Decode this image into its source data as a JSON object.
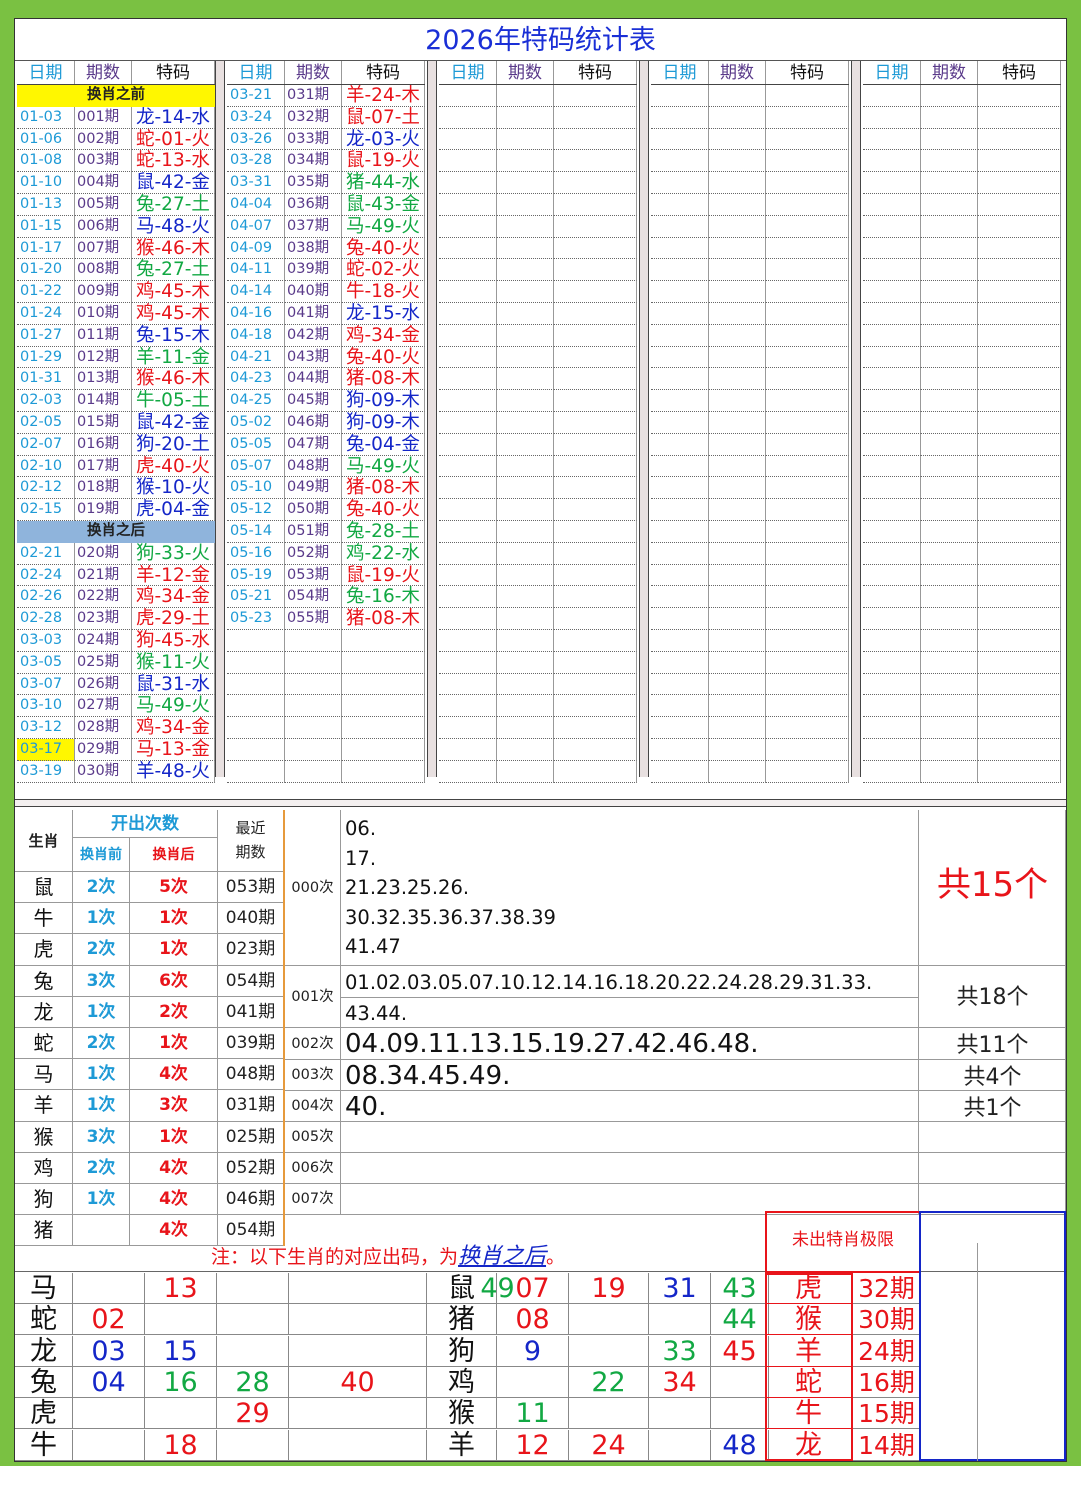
{
  "title": "2026年特码统计表",
  "headers": {
    "date": "日期",
    "num": "期数",
    "code": "特码"
  },
  "band_before": "换肖之前",
  "band_after": "换肖之后",
  "col1": [
    [
      "01-03",
      "001期",
      "龙-14-水",
      "blue"
    ],
    [
      "01-06",
      "002期",
      "蛇-01-火",
      "red"
    ],
    [
      "01-08",
      "003期",
      "蛇-13-水",
      "red"
    ],
    [
      "01-10",
      "004期",
      "鼠-42-金",
      "blue"
    ],
    [
      "01-13",
      "005期",
      "兔-27-土",
      "green"
    ],
    [
      "01-15",
      "006期",
      "马-48-火",
      "blue"
    ],
    [
      "01-17",
      "007期",
      "猴-46-木",
      "red"
    ],
    [
      "01-20",
      "008期",
      "兔-27-土",
      "green"
    ],
    [
      "01-22",
      "009期",
      "鸡-45-木",
      "red"
    ],
    [
      "01-24",
      "010期",
      "鸡-45-木",
      "red"
    ],
    [
      "01-27",
      "011期",
      "兔-15-木",
      "blue"
    ],
    [
      "01-29",
      "012期",
      "羊-11-金",
      "green"
    ],
    [
      "01-31",
      "013期",
      "猴-46-木",
      "red"
    ],
    [
      "02-03",
      "014期",
      "牛-05-土",
      "green"
    ],
    [
      "02-05",
      "015期",
      "鼠-42-金",
      "blue"
    ],
    [
      "02-07",
      "016期",
      "狗-20-土",
      "blue"
    ],
    [
      "02-10",
      "017期",
      "虎-40-火",
      "red"
    ],
    [
      "02-12",
      "018期",
      "猴-10-火",
      "blue"
    ],
    [
      "02-15",
      "019期",
      "虎-04-金",
      "blue"
    ]
  ],
  "col1b": [
    [
      "02-21",
      "020期",
      "狗-33-火",
      "green"
    ],
    [
      "02-24",
      "021期",
      "羊-12-金",
      "red"
    ],
    [
      "02-26",
      "022期",
      "鸡-34-金",
      "red"
    ],
    [
      "02-28",
      "023期",
      "虎-29-土",
      "red"
    ],
    [
      "03-03",
      "024期",
      "狗-45-水",
      "red"
    ],
    [
      "03-05",
      "025期",
      "猴-11-火",
      "green"
    ],
    [
      "03-07",
      "026期",
      "鼠-31-水",
      "blue"
    ],
    [
      "03-10",
      "027期",
      "马-49-火",
      "green"
    ],
    [
      "03-12",
      "028期",
      "鸡-34-金",
      "red"
    ],
    [
      "03-17",
      "029期",
      "马-13-金",
      "red"
    ],
    [
      "03-19",
      "030期",
      "羊-48-火",
      "blue"
    ]
  ],
  "col2": [
    [
      "03-21",
      "031期",
      "羊-24-木",
      "red"
    ],
    [
      "03-24",
      "032期",
      "鼠-07-土",
      "red"
    ],
    [
      "03-26",
      "033期",
      "龙-03-火",
      "blue"
    ],
    [
      "03-28",
      "034期",
      "鼠-19-火",
      "red"
    ],
    [
      "03-31",
      "035期",
      "猪-44-水",
      "green"
    ],
    [
      "04-04",
      "036期",
      "鼠-43-金",
      "green"
    ],
    [
      "04-07",
      "037期",
      "马-49-火",
      "green"
    ],
    [
      "04-09",
      "038期",
      "兔-40-火",
      "red"
    ],
    [
      "04-11",
      "039期",
      "蛇-02-火",
      "red"
    ],
    [
      "04-14",
      "040期",
      "牛-18-火",
      "red"
    ],
    [
      "04-16",
      "041期",
      "龙-15-水",
      "blue"
    ],
    [
      "04-18",
      "042期",
      "鸡-34-金",
      "red"
    ],
    [
      "04-21",
      "043期",
      "兔-40-火",
      "red"
    ],
    [
      "04-23",
      "044期",
      "猪-08-木",
      "red"
    ],
    [
      "04-25",
      "045期",
      "狗-09-木",
      "blue"
    ],
    [
      "05-02",
      "046期",
      "狗-09-木",
      "blue"
    ],
    [
      "05-05",
      "047期",
      "兔-04-金",
      "blue"
    ],
    [
      "05-07",
      "048期",
      "马-49-火",
      "green"
    ],
    [
      "05-10",
      "049期",
      "猪-08-木",
      "red"
    ],
    [
      "05-12",
      "050期",
      "兔-40-火",
      "red"
    ],
    [
      "05-14",
      "051期",
      "兔-28-土",
      "green"
    ],
    [
      "05-16",
      "052期",
      "鸡-22-水",
      "green"
    ],
    [
      "05-19",
      "053期",
      "鼠-19-火",
      "red"
    ],
    [
      "05-21",
      "054期",
      "兔-16-木",
      "green"
    ],
    [
      "05-23",
      "055期",
      "猪-08-木",
      "red"
    ]
  ],
  "stats": {
    "h_zodiac": "生肖",
    "h_count": "开出次数",
    "h_before": "换肖前",
    "h_after": "换肖后",
    "h_recent": "最近期数",
    "rows": [
      [
        "鼠",
        "2次",
        "5次",
        "053期"
      ],
      [
        "牛",
        "1次",
        "1次",
        "040期"
      ],
      [
        "虎",
        "2次",
        "1次",
        "023期"
      ],
      [
        "兔",
        "3次",
        "6次",
        "054期"
      ],
      [
        "龙",
        "1次",
        "2次",
        "041期"
      ],
      [
        "蛇",
        "2次",
        "1次",
        "039期"
      ],
      [
        "马",
        "1次",
        "4次",
        "048期"
      ],
      [
        "羊",
        "1次",
        "3次",
        "031期"
      ],
      [
        "猴",
        "3次",
        "1次",
        "025期"
      ],
      [
        "鸡",
        "2次",
        "4次",
        "052期"
      ],
      [
        "狗",
        "1次",
        "4次",
        "046期"
      ],
      [
        "猪",
        "",
        "4次",
        "054期"
      ]
    ],
    "tiers": [
      "000次",
      "001次",
      "002次",
      "003次",
      "004次",
      "005次",
      "006次",
      "007次"
    ],
    "t0_lines": [
      "06.",
      "17.",
      "21.23.25.26.",
      "30.32.35.36.37.38.39",
      "41.47"
    ],
    "t0_total": "共15个",
    "t1_lines": [
      "01.02.03.05.07.10.12.14.16.18.20.22.24.28.29.31.33.",
      "43.44."
    ],
    "t1_total": "共18个",
    "t2": "04.09.11.13.15.19.27.42.46.48.",
    "t2_total": "共11个",
    "t3": "08.34.45.49.",
    "t3_total": "共4个",
    "t4": "40.",
    "t4_total": "共1个"
  },
  "note_prefix": "注：以下生肖的对应出码，为",
  "note_link": "换肖之后",
  "note_suffix": "。",
  "limit_title": "未出特肖极限",
  "lower_left": [
    [
      "马",
      "",
      "13",
      "",
      "",
      "49"
    ],
    [
      "蛇",
      "02",
      "",
      "",
      "",
      ""
    ],
    [
      "龙",
      "03",
      "15",
      "",
      "",
      ""
    ],
    [
      "兔",
      "04",
      "16",
      "28",
      "40",
      ""
    ],
    [
      "虎",
      "",
      "",
      "29",
      "",
      ""
    ],
    [
      "牛",
      "",
      "18",
      "",
      "",
      ""
    ]
  ],
  "lower_right": [
    [
      "鼠",
      "07",
      "19",
      "31",
      "43"
    ],
    [
      "猪",
      "08",
      "",
      "",
      "44"
    ],
    [
      "狗",
      "9",
      "",
      "33",
      "45"
    ],
    [
      "鸡",
      "",
      "22",
      "34",
      ""
    ],
    [
      "猴",
      "11",
      "",
      "",
      ""
    ],
    [
      "羊",
      "12",
      "24",
      "",
      "48"
    ]
  ],
  "limits": [
    [
      "虎",
      "32期"
    ],
    [
      "猴",
      "30期"
    ],
    [
      "羊",
      "24期"
    ],
    [
      "蛇",
      "16期"
    ],
    [
      "牛",
      "15期"
    ],
    [
      "龙",
      "14期"
    ]
  ]
}
